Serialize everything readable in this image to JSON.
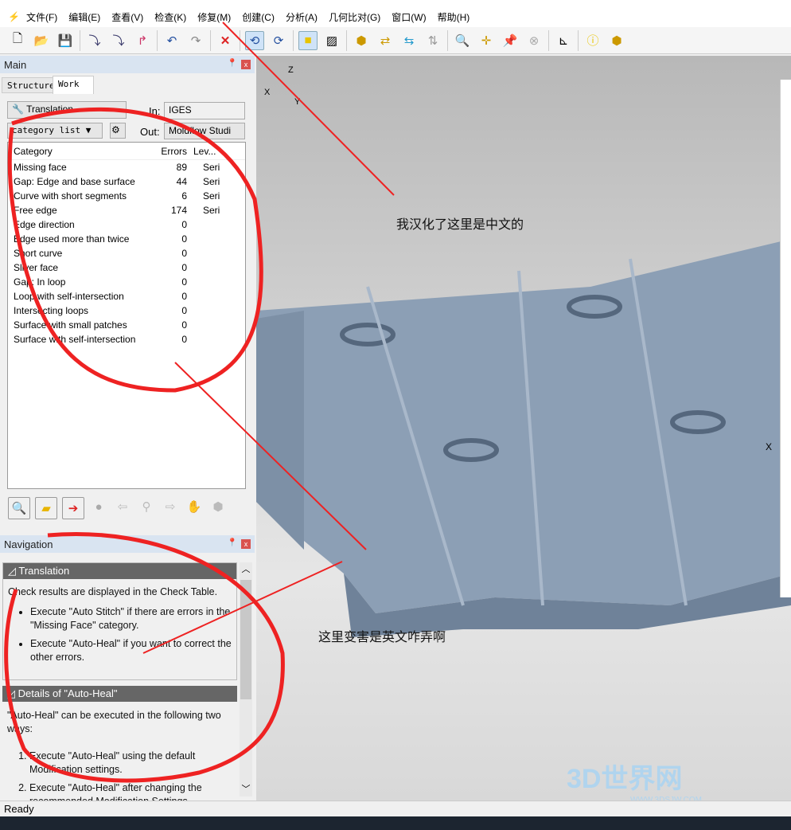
{
  "menu": [
    "文件(F)",
    "编辑(E)",
    "查看(V)",
    "检查(K)",
    "修复(M)",
    "创建(C)",
    "分析(A)",
    "几何比对(G)",
    "窗口(W)",
    "帮助(H)"
  ],
  "main_panel": {
    "title": "Main",
    "tabs": [
      "Structure",
      "Work"
    ],
    "mode": "Translation",
    "view_select": "category list",
    "in_label": "In:",
    "in_value": "IGES",
    "out_label": "Out:",
    "out_value": "Moldflow Studi",
    "columns": [
      "Category",
      "Errors",
      "Lev..."
    ],
    "rows": [
      [
        "Missing face",
        "89",
        "Seri"
      ],
      [
        "Gap: Edge and base surface",
        "44",
        "Seri"
      ],
      [
        "Curve with short segments",
        "6",
        "Seri"
      ],
      [
        "Free edge",
        "174",
        "Seri"
      ],
      [
        "Edge direction",
        "0",
        ""
      ],
      [
        "Edge used more than twice",
        "0",
        ""
      ],
      [
        "Short curve",
        "0",
        ""
      ],
      [
        "Sliver face",
        "0",
        ""
      ],
      [
        "Gap: In loop",
        "0",
        ""
      ],
      [
        "Loop with self-intersection",
        "0",
        ""
      ],
      [
        "Intersecting loops",
        "0",
        ""
      ],
      [
        "Surface with small patches",
        "0",
        ""
      ],
      [
        "Surface with self-intersection",
        "0",
        ""
      ]
    ]
  },
  "nav_panel": {
    "title": "Navigation",
    "section1": "Translation",
    "intro": "Check results are displayed in the Check Table.",
    "bullet1": "Execute \"Auto Stitch\" if there are errors in the \"Missing Face\" category.",
    "bullet2": "Execute \"Auto-Heal\" if you want to correct the other errors.",
    "section2": "Details of \"Auto-Heal\"",
    "details": "\"Auto-Heal\" can be executed in the following two ways:",
    "step1": "Execute \"Auto-Heal\" using the default Modification settings.",
    "step2": "Execute \"Auto-Heal\" after changing the recommended Modification Settings."
  },
  "viewport": {
    "axis_x": "X",
    "axis_y": "Y",
    "axis_z": "Z",
    "axis_x_right": "X"
  },
  "annotations": {
    "top": "我汉化了这里是中文的",
    "bottom": "这里变害是英文咋弄啊",
    "color": "#ee2222"
  },
  "watermark": {
    "brand": "3D世界网",
    "url": "WWW.3DSJW.COM"
  },
  "status": "Ready"
}
